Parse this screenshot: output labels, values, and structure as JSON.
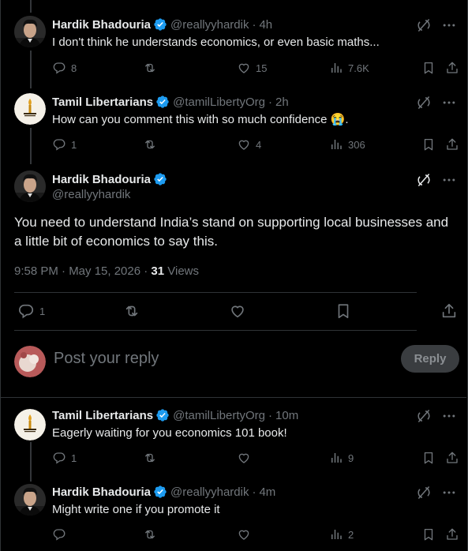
{
  "tweets": [
    {
      "name": "Hardik Bhadouria",
      "handle": "@reallyyhardik",
      "time": "4h",
      "text": "I don't think he understands economics, or even basic maths...",
      "replies": "8",
      "retweets": "",
      "likes": "15",
      "views": "7.6K"
    },
    {
      "name": "Tamil Libertarians",
      "handle": "@tamilLibertyOrg",
      "time": "2h",
      "text": "How can you comment this with so much confidence 😭.",
      "replies": "1",
      "retweets": "",
      "likes": "4",
      "views": "306"
    }
  ],
  "main": {
    "name": "Hardik Bhadouria",
    "handle": "@reallyyhardik",
    "text": "You need to understand India’s stand on supporting local businesses and a little bit of economics to say this.",
    "timestamp": "9:58 PM · May 15, 2026 · ",
    "views_count": "31",
    "views_label": " Views",
    "replies": "1"
  },
  "reply_box": {
    "placeholder": "Post your reply",
    "button": "Reply"
  },
  "replies_below": [
    {
      "name": "Tamil Libertarians",
      "handle": "@tamilLibertyOrg",
      "time": "10m",
      "text": "Eagerly waiting for you economics 101 book!",
      "replies": "1",
      "likes": "",
      "views": "9"
    },
    {
      "name": "Hardik Bhadouria",
      "handle": "@reallyyhardik",
      "time": "4m",
      "text": "Might write one if you promote it",
      "replies": "",
      "likes": "",
      "views": "2"
    }
  ],
  "separator": "·",
  "icons": {
    "verified": "verified-badge-icon",
    "grok": "grok-icon",
    "more": "more-icon",
    "reply": "reply-icon",
    "retweet": "retweet-icon",
    "like": "heart-icon",
    "views": "views-icon",
    "bookmark": "bookmark-icon",
    "share": "share-icon"
  },
  "colors": {
    "background": "#000000",
    "text": "#e7e9ea",
    "muted": "#71767b",
    "verified": "#1d9bf0",
    "divider": "#2f3336"
  }
}
